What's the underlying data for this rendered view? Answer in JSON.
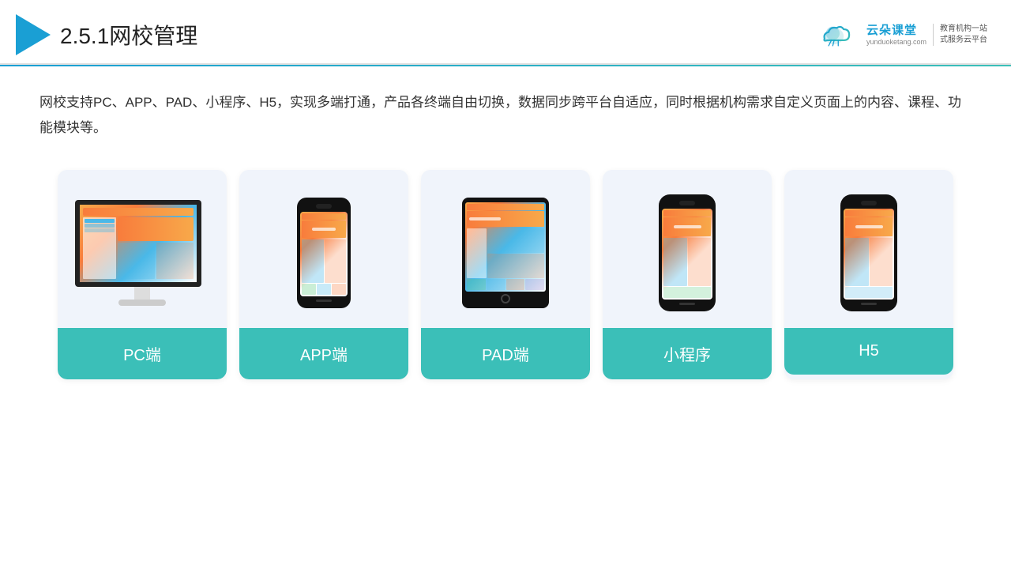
{
  "header": {
    "section_number": "2.5.1",
    "title": "网校管理",
    "logo": {
      "name": "云朵课堂",
      "domain": "yunduoketang.com",
      "slogan_line1": "教育机构一站",
      "slogan_line2": "式服务云平台"
    }
  },
  "description": "网校支持PC、APP、PAD、小程序、H5，实现多端打通，产品各终端自由切换，数据同步跨平台自适应，同时根据机构需求自定义页面上的内容、课程、功能模块等。",
  "cards": [
    {
      "id": "pc",
      "label": "PC端"
    },
    {
      "id": "app",
      "label": "APP端"
    },
    {
      "id": "pad",
      "label": "PAD端"
    },
    {
      "id": "miniapp",
      "label": "小程序"
    },
    {
      "id": "h5",
      "label": "H5"
    }
  ],
  "colors": {
    "accent": "#1a9fd4",
    "teal": "#3bbfb8",
    "card_bg": "#eef2fb",
    "orange": "#f87c3c"
  }
}
